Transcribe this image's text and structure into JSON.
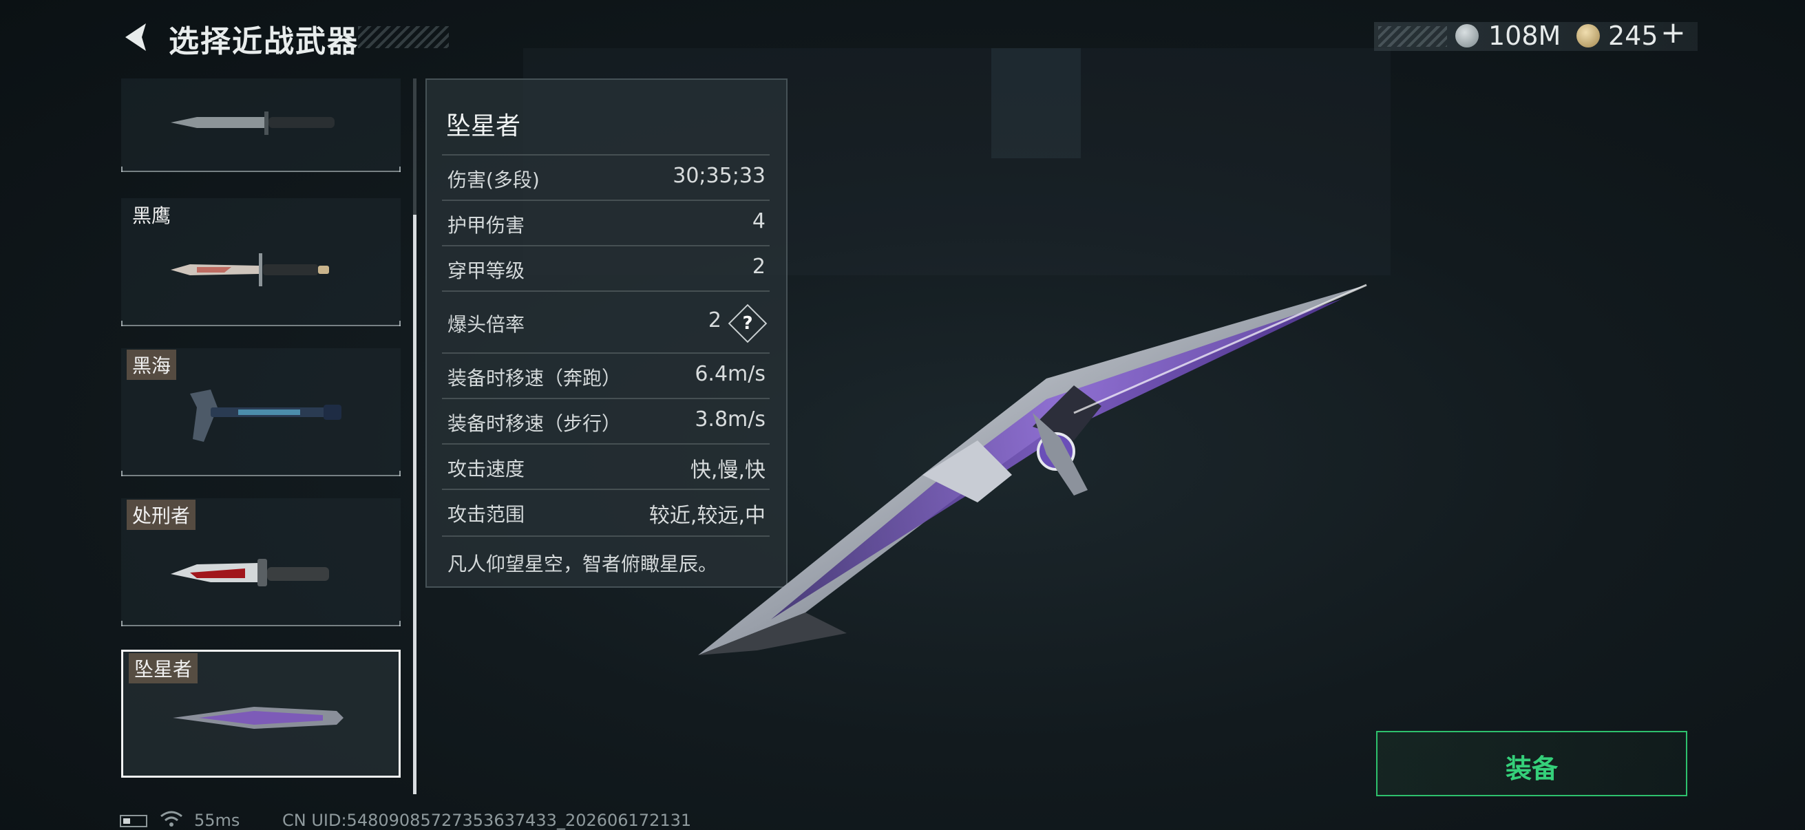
{
  "header": {
    "title": "选择近战武器"
  },
  "currency": {
    "coins_value": "108M",
    "tokens_value": "245",
    "plus_symbol": "+"
  },
  "weapons": [
    {
      "name": "",
      "tag": false
    },
    {
      "name": "黑鹰",
      "tag": false
    },
    {
      "name": "黑海",
      "tag": true
    },
    {
      "name": "处刑者",
      "tag": true
    },
    {
      "name": "坠星者",
      "tag": true,
      "selected": true
    }
  ],
  "stats": {
    "name": "坠星者",
    "rows": [
      {
        "label": "伤害(多段)",
        "value": "30;35;33"
      },
      {
        "label": "护甲伤害",
        "value": "4"
      },
      {
        "label": "穿甲等级",
        "value": "2"
      },
      {
        "label": "爆头倍率",
        "value": "2",
        "help": "?"
      },
      {
        "label": "装备时移速（奔跑）",
        "value": "6.4m/s"
      },
      {
        "label": "装备时移速（步行）",
        "value": "3.8m/s"
      },
      {
        "label": "攻击速度",
        "value": "快,慢,快"
      },
      {
        "label": "攻击范围",
        "value": "较近,较远,中"
      }
    ],
    "description": "凡人仰望星空，智者俯瞰星辰。"
  },
  "equip_button": {
    "label": "装备"
  },
  "status_bar": {
    "ping": "55ms",
    "uid": "CN UID:54809085727353637433_202606172131"
  },
  "colors": {
    "accent_green": "#35d07a",
    "background": "#121a1e"
  }
}
